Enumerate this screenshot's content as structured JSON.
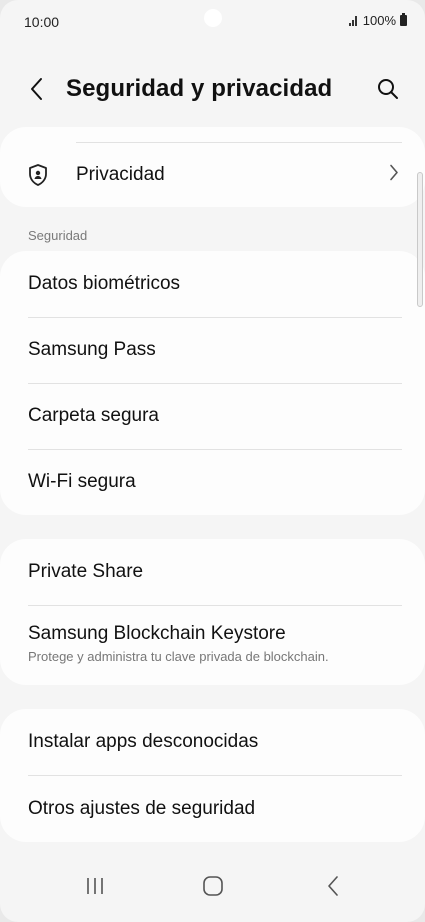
{
  "status_bar": {
    "time": "10:00",
    "battery_text": "100%"
  },
  "header": {
    "title": "Seguridad y privacidad",
    "back_icon": "chevron-left-icon",
    "search_icon": "search-icon"
  },
  "privacy_card": {
    "label": "Privacidad",
    "icon": "shield-person-icon"
  },
  "security_section": {
    "label": "Seguridad",
    "items": [
      {
        "label": "Datos biométricos"
      },
      {
        "label": "Samsung Pass"
      },
      {
        "label": "Carpeta segura"
      },
      {
        "label": "Wi-Fi segura"
      }
    ]
  },
  "share_card": {
    "items": [
      {
        "label": "Private Share"
      },
      {
        "label": "Samsung Blockchain Keystore",
        "sub": "Protege y administra tu clave privada de blockchain."
      }
    ]
  },
  "other_card": {
    "items": [
      {
        "label": "Instalar apps desconocidas"
      },
      {
        "label": "Otros ajustes de seguridad"
      }
    ]
  },
  "navbar": {
    "recents_icon": "recents-icon",
    "home_icon": "home-icon",
    "back_icon": "back-icon"
  },
  "colors": {
    "background": "#f5f5f5",
    "card": "#fdfdfd",
    "text": "#111111",
    "secondary_text": "#777777"
  }
}
